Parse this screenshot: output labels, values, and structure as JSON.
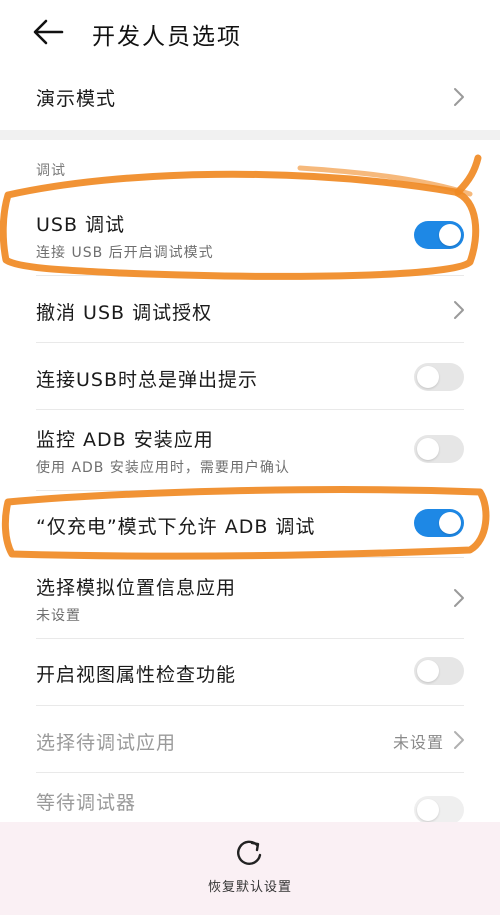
{
  "header": {
    "title": "开发人员选项",
    "back_icon": "arrow-left-icon"
  },
  "demo_mode": {
    "title": "演示模式"
  },
  "section": {
    "label": "调试"
  },
  "usb_debugging": {
    "title": "USB 调试",
    "subtitle": "连接 USB 后开启调试模式",
    "enabled": true
  },
  "revoke_usb": {
    "title": "撤消 USB 调试授权"
  },
  "usb_prompt": {
    "title": "连接USB时总是弹出提示",
    "enabled": false
  },
  "monitor_adb": {
    "title": "监控 ADB 安装应用",
    "subtitle": "使用 ADB 安装应用时，需要用户确认",
    "enabled": false
  },
  "charge_only_adb": {
    "title": "“仅充电”模式下允许 ADB 调试",
    "enabled": true
  },
  "mock_location": {
    "title": "选择模拟位置信息应用",
    "subtitle": "未设置"
  },
  "view_attr": {
    "title": "开启视图属性检查功能",
    "enabled": false
  },
  "debug_app": {
    "title": "选择待调试应用",
    "value": "未设置"
  },
  "wait_debugger": {
    "title": "等待调试器",
    "enabled": false
  },
  "footer": {
    "reset_label": "恢复默认设置",
    "reset_icon": "refresh-icon"
  },
  "colors": {
    "accent": "#1e88e5",
    "annotation": "#f08a24",
    "footer_bg": "#faf0f4"
  }
}
